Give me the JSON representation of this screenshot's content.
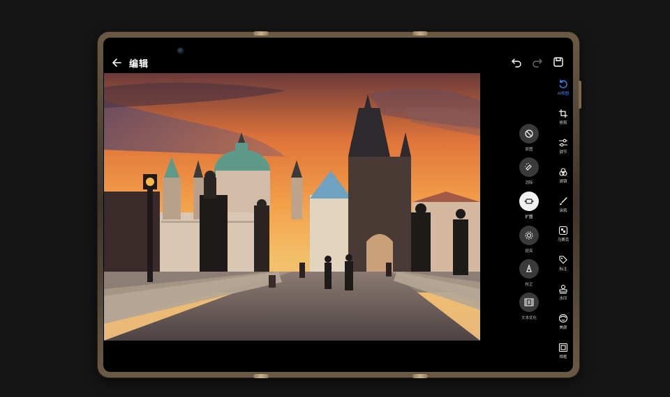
{
  "header": {
    "title": "编辑"
  },
  "toolbar": {
    "undo_icon": "undo-icon",
    "redo_icon": "redo-icon",
    "save_icon": "save-icon"
  },
  "edit_tools": [
    {
      "label": "原图",
      "icon": "no-sign-icon",
      "active": false
    },
    {
      "label": "消除",
      "icon": "eraser-sparkle-icon",
      "active": false
    },
    {
      "label": "扩图",
      "icon": "expand-image-icon",
      "active": true
    },
    {
      "label": "提亮",
      "icon": "brighten-icon",
      "active": false
    },
    {
      "label": "校正",
      "icon": "correct-icon",
      "active": false
    },
    {
      "label": "文本优化",
      "icon": "text-optimize-icon",
      "active": false
    }
  ],
  "side_nav": [
    {
      "label": "AI修图",
      "icon": "ai-retouch-icon",
      "active": true
    },
    {
      "label": "修剪",
      "icon": "crop-icon",
      "active": false
    },
    {
      "label": "调节",
      "icon": "adjust-sliders-icon",
      "active": false
    },
    {
      "label": "滤镜",
      "icon": "filter-circles-icon",
      "active": false
    },
    {
      "label": "涂鸦",
      "icon": "brush-icon",
      "active": false
    },
    {
      "label": "马赛克",
      "icon": "mosaic-icon",
      "active": false
    },
    {
      "label": "标注",
      "icon": "tag-icon",
      "active": false
    },
    {
      "label": "水印",
      "icon": "stamp-icon",
      "active": false
    },
    {
      "label": "美颜",
      "icon": "beauty-icon",
      "active": false
    },
    {
      "label": "相框",
      "icon": "frame-icon",
      "active": false
    }
  ],
  "colors": {
    "accent": "#3b8bff",
    "frame": "#6b5a44"
  }
}
